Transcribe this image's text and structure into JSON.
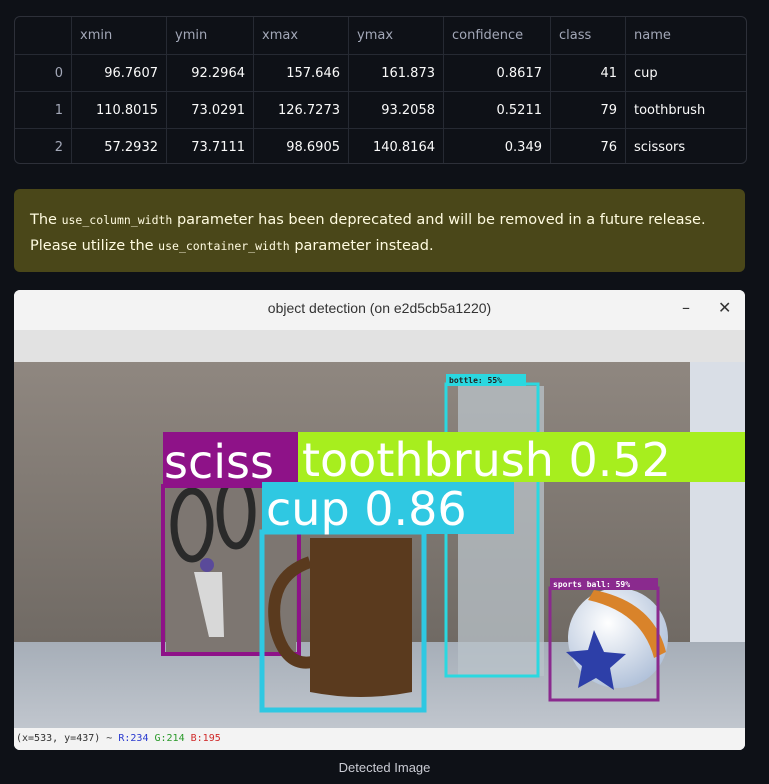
{
  "table": {
    "columns": [
      "",
      "xmin",
      "ymin",
      "xmax",
      "ymax",
      "confidence",
      "class",
      "name"
    ],
    "rows": [
      [
        "0",
        "96.7607",
        "92.2964",
        "157.646",
        "161.873",
        "0.8617",
        "41",
        "cup"
      ],
      [
        "1",
        "110.8015",
        "73.0291",
        "126.7273",
        "93.2058",
        "0.5211",
        "79",
        "toothbrush"
      ],
      [
        "2",
        "57.2932",
        "73.7111",
        "98.6905",
        "140.8164",
        "0.349",
        "76",
        "scissors"
      ]
    ]
  },
  "warning": {
    "part1": "The ",
    "code1": "use_column_width",
    "part2": " parameter has been deprecated and will be removed in a future release. Please utilize the ",
    "code2": "use_container_width",
    "part3": " parameter instead.",
    "color": "#4a4719"
  },
  "window": {
    "title": "object detection (on e2d5cb5a1220)",
    "minimize_glyph": "–",
    "close_glyph": "✕"
  },
  "detections": {
    "scissors_label": "sciss",
    "toothbrush_label": "toothbrush 0.52",
    "cup_label": "cup 0.86",
    "bottle_label": "bottle: 55%",
    "ball_label": "sports ball: 59%"
  },
  "status": {
    "coords": "(x=533, y=437) ~",
    "r": "R:234",
    "g": "G:214",
    "b": "B:195"
  },
  "caption": "Detected Image",
  "colors": {
    "scissors": "#8e1288",
    "toothbrush": "#a7ee1e",
    "cup": "#2fc8e2",
    "bottle": "#2ad8e0",
    "ball": "#8a2a8e"
  }
}
